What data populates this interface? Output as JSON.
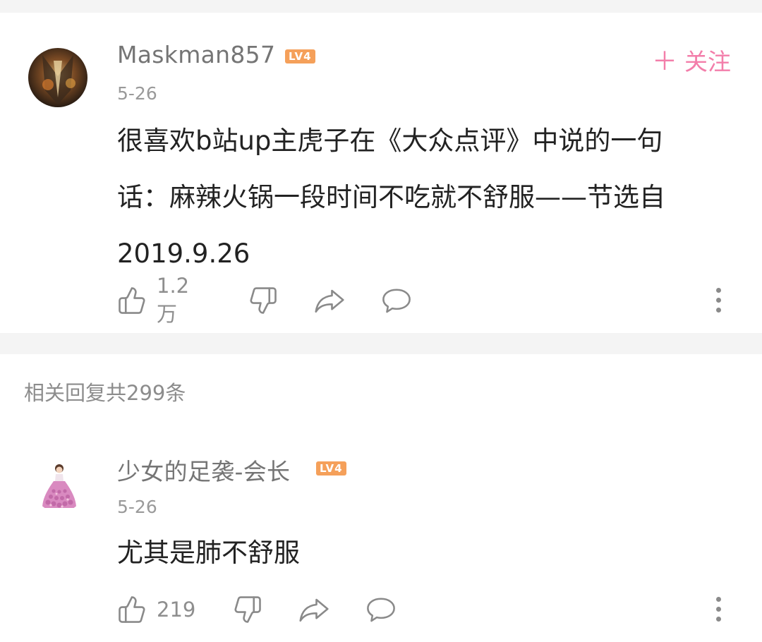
{
  "main_comment": {
    "username": "Maskman857",
    "level": "LV4",
    "date": "5-26",
    "follow_label": "关注",
    "content_lines": [
      "很喜欢b站up主虎子在《大众点评》中说的一句",
      "话：麻辣火锅一段时间不吃就不舒服——节选自",
      "2019.9.26"
    ],
    "like_count": "1.2万"
  },
  "replies_header": "相关回复共299条",
  "reply": {
    "username": "少女的足袭-会长",
    "level": "LV4",
    "date": "5-26",
    "content": "尤其是肺不舒服",
    "like_count": "219"
  },
  "icons": {
    "like": "thumbs-up-icon",
    "dislike": "thumbs-down-icon",
    "share": "share-icon",
    "comment": "comment-bubble-icon",
    "more": "more-vertical-icon",
    "follow": "plus-icon"
  },
  "colors": {
    "follow_pink": "#f37eaa",
    "level_badge": "#f5a05a",
    "username_gray": "#757575",
    "meta_gray": "#9a9a9a",
    "text": "#222222",
    "separator": "#f4f4f4"
  }
}
